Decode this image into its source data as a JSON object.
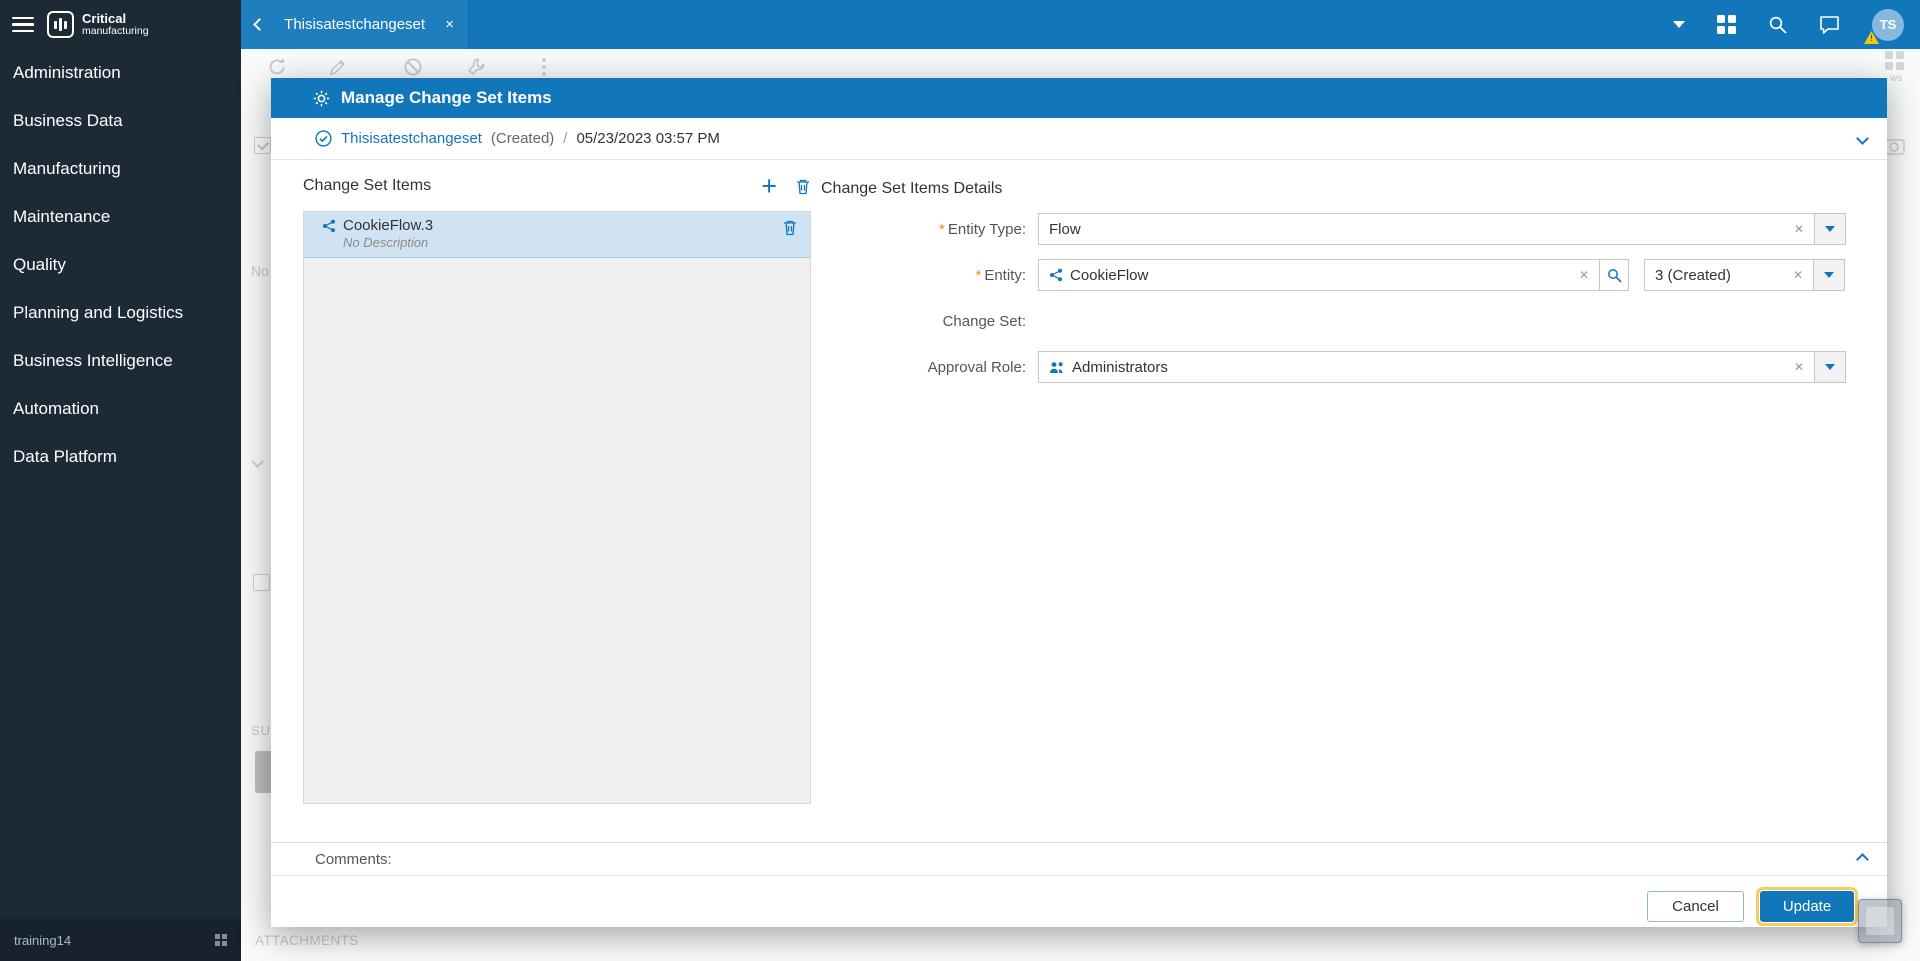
{
  "colors": {
    "accent": "#1176ba",
    "sidebar_bg": "#1d2a36",
    "selection_bg": "#cfe3f2",
    "focus_ring": "#f2cf5b",
    "warning": "#f2c513",
    "required_marker_color": "#ef9400"
  },
  "icons": {
    "clear": "✕",
    "plus": "+"
  },
  "topbar": {
    "brand": {
      "line1": "Critical",
      "line2": "manufacturing"
    },
    "tab": {
      "label": "Thisisatestchangeset",
      "close_icon": "×"
    },
    "avatar": {
      "initials": "TS",
      "warning": "!"
    }
  },
  "sidebar": {
    "items": [
      "Administration",
      "Business Data",
      "Manufacturing",
      "Maintenance",
      "Quality",
      "Planning and Logistics",
      "Business Intelligence",
      "Automation",
      "Data Platform"
    ],
    "footer": {
      "username": "training14"
    }
  },
  "background_page": {
    "fragment_no": "No",
    "fragment_su": "SU",
    "fragment_views": "ws",
    "attachments_label": "ATTACHMENTS"
  },
  "modal": {
    "title": "Manage Change Set Items",
    "breadcrumb": {
      "name": "Thisisatestchangeset",
      "state": "(Created)",
      "separator": "/",
      "timestamp": "05/23/2023 03:57 PM"
    },
    "items_panel": {
      "title": "Change Set Items",
      "items": [
        {
          "name": "CookieFlow.3",
          "description": "No Description"
        }
      ]
    },
    "details": {
      "title": "Change Set Items Details",
      "required_marker": "*",
      "entity_type": {
        "label": "Entity Type:",
        "value": "Flow"
      },
      "entity": {
        "label": "Entity:",
        "value": "CookieFlow",
        "version": "3 (Created)"
      },
      "change_set": {
        "label": "Change Set:"
      },
      "approval_role": {
        "label": "Approval Role:",
        "value": "Administrators"
      }
    },
    "comments": {
      "label": "Comments:"
    },
    "footer": {
      "cancel_label": "Cancel",
      "update_label": "Update"
    }
  }
}
